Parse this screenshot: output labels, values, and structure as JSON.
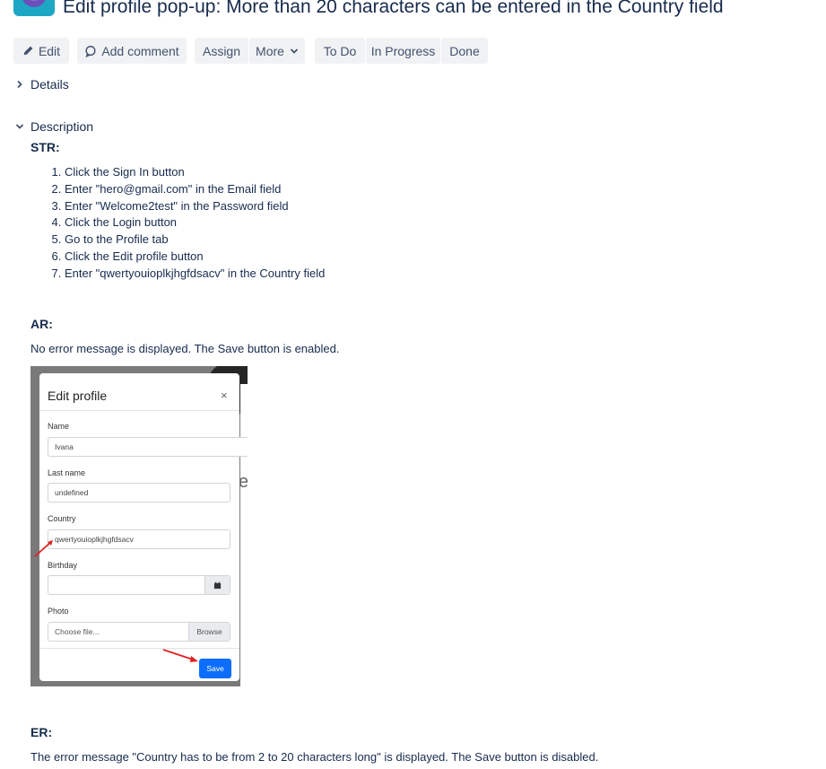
{
  "issue": {
    "title": "Edit profile pop-up: More than 20 characters can be entered in the Country field"
  },
  "toolbar": {
    "edit_label": "Edit",
    "add_comment_label": "Add comment",
    "assign_label": "Assign",
    "more_label": "More",
    "todo_label": "To Do",
    "in_progress_label": "In Progress",
    "done_label": "Done"
  },
  "details": {
    "label": "Details"
  },
  "description": {
    "label": "Description",
    "str_heading": "STR:",
    "steps": [
      "Click the Sign In button",
      "Enter \"hero@gmail.com\" in the Email field",
      "Enter \"Welcome2test\" in the Password field",
      "Click the Login button",
      "Go to the Profile tab",
      "Click the Edit profile button",
      "Enter \"qwertyouioplkjhgfdsacv\" in the Country field"
    ],
    "ar_heading": "AR:",
    "ar_text": "No error message is displayed. The Save button is enabled.",
    "er_heading": "ER:",
    "er_text": "The error message \"Country has to be from 2 to 20 characters long\" is displayed. The Save button is disabled."
  },
  "screenshot": {
    "modal_title": "Edit profile",
    "close_glyph": "×",
    "name_label": "Name",
    "name_value": "Ivana",
    "last_name_label": "Last name",
    "last_name_value": "undefined",
    "country_label": "Country",
    "country_value": "qwertyouioplkjhgfdsacv",
    "birthday_label": "Birthday",
    "photo_label": "Photo",
    "photo_placeholder": "Choose file...",
    "browse_label": "Browse",
    "save_label": "Save",
    "background_letter": "e"
  },
  "colors": {
    "button_bg": "#f1f2f4",
    "text": "#172b4d",
    "save_blue": "#0d6efd",
    "annotation_red": "#e02020"
  },
  "icons": {
    "edit": "pencil-icon",
    "comment": "comment-bubble-icon",
    "more": "chevron-down-icon",
    "details": "chevron-right-icon",
    "description": "chevron-down-icon",
    "calendar": "calendar-icon"
  }
}
